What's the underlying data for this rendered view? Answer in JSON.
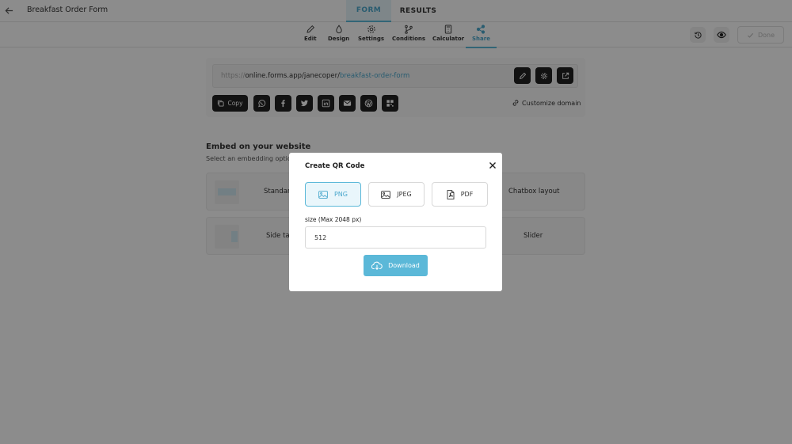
{
  "header": {
    "back_icon": "arrow-left-icon",
    "title": "Breakfast Order Form",
    "tabs": [
      {
        "label": "FORM",
        "active": true
      },
      {
        "label": "RESULTS",
        "active": false
      }
    ]
  },
  "toolbar": {
    "items": [
      {
        "label": "Edit",
        "icon": "pencil-icon"
      },
      {
        "label": "Design",
        "icon": "drop-icon"
      },
      {
        "label": "Settings",
        "icon": "gear-icon"
      },
      {
        "label": "Conditions",
        "icon": "branch-icon"
      },
      {
        "label": "Calculator",
        "icon": "calculator-icon"
      },
      {
        "label": "Share",
        "icon": "share-icon",
        "active": true
      }
    ],
    "done_label": "Done"
  },
  "share": {
    "url_prefix": "https://",
    "url_domain": "online.forms.app/janecoper/",
    "url_slug": "breakfast-order-form",
    "copy_label": "Copy",
    "customize_label": "Customize domain",
    "social_icons": [
      "whatsapp-icon",
      "facebook-icon",
      "twitter-icon",
      "linkedin-icon",
      "email-icon",
      "wordpress-icon",
      "qr-code-icon"
    ]
  },
  "embed": {
    "title": "Embed on your website",
    "subtitle": "Select an embedding optio",
    "options": [
      {
        "label": "Standar"
      },
      {
        "label": "Chatbox layout"
      },
      {
        "label": "Side tal"
      },
      {
        "label": "Slider"
      }
    ]
  },
  "modal": {
    "title": "Create QR Code",
    "formats": [
      {
        "label": "PNG",
        "icon": "image-icon",
        "selected": true
      },
      {
        "label": "JPEG",
        "icon": "image-icon",
        "selected": false
      },
      {
        "label": "PDF",
        "icon": "pdf-file-icon",
        "selected": false
      }
    ],
    "size_label": "size (Max 2048 px)",
    "size_value": "512",
    "download_label": "Download"
  },
  "colors": {
    "accent": "#5bb8d8",
    "accent_text": "#4ba8cd",
    "dark_button": "#222222",
    "overlay": "rgba(0,0,0,0.45)"
  }
}
